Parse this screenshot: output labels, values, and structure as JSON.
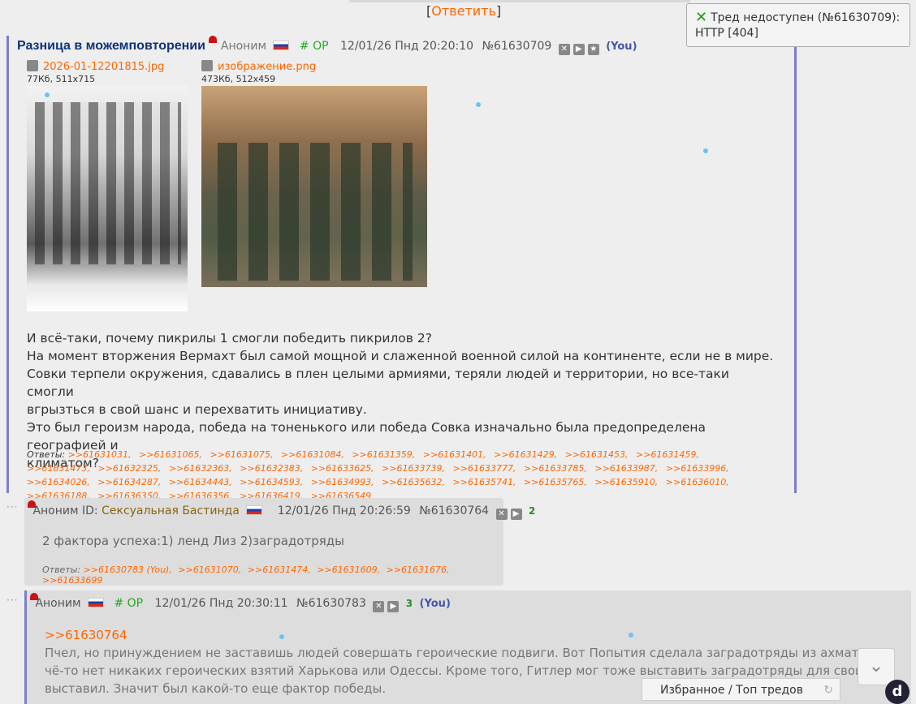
{
  "top_reply": {
    "open": "[",
    "label": "Ответить",
    "close": "]"
  },
  "notice": {
    "text_line1": "Тред недоступен (№61630709):",
    "text_line2": "HTTP [404]"
  },
  "op": {
    "title": "Разница в можемповторении",
    "author": "Аноним",
    "op_tag": "# OP",
    "date": "12/01/26 Пнд 20:20:10",
    "number": "№61630709",
    "you": "(You)",
    "files": [
      {
        "name": "2026-01-12201815.jpg",
        "meta": "77Кб, 511x715"
      },
      {
        "name": "изображение.png",
        "meta": "473Кб, 512x459"
      }
    ],
    "body": [
      "И всё-таки, почему пикрилы 1 смогли победить пикрилов 2?",
      "На момент вторжения Вермахт был самой мощной и слаженной военной силой на континенте, если не в мире.",
      "Совки терпели окружения, сдавались в плен целыми армиями, теряли людей и территории, но все-таки смогли",
      "вгрызться в свой шанс и перехватить инициативу.",
      "Это был героизм народа, победа на тоненького или победа Совка изначально была предопределена географией и",
      "климатом?"
    ],
    "replies_label": "Ответы:",
    "replies": [
      ">>61631031",
      ">>61631065",
      ">>61631075",
      ">>61631084",
      ">>61631359",
      ">>61631401",
      ">>61631429",
      ">>61631453",
      ">>61631459",
      ">>61631473",
      ">>61632325",
      ">>61632363",
      ">>61632383",
      ">>61633625",
      ">>61633739",
      ">>61633777",
      ">>61633785",
      ">>61633987",
      ">>61633996",
      ">>61634026",
      ">>61634287",
      ">>61634443",
      ">>61634593",
      ">>61634993",
      ">>61635632",
      ">>61635741",
      ">>61635765",
      ">>61635910",
      ">>61636010",
      ">>61636188",
      ">>61636350",
      ">>61636356",
      ">>61636419",
      ">>61636549"
    ]
  },
  "reply1": {
    "author": "Аноним",
    "id_label": "ID:",
    "id_name": "Сексуальная Бастинда",
    "date": "12/01/26 Пнд 20:26:59",
    "number": "№61630764",
    "count": "2",
    "body": "2 фактора успеха:1) ленд Лиз 2)заградотряды",
    "replies_label": "Ответы:",
    "replies": [
      ">>61630783 (You),",
      ">>61631070,",
      ">>61631474,",
      ">>61631609,",
      ">>61631676,",
      ">>61633699"
    ]
  },
  "reply2": {
    "author": "Аноним",
    "op_tag": "# OP",
    "date": "12/01/26 Пнд 20:30:11",
    "number": "№61630783",
    "count": "3",
    "you": "(You)",
    "quote": ">>61630764",
    "body": [
      "Пчел, но принуждением не заставишь людей совершать героические подвиги. Вот Попытия сделала заградотряды из ахматовце",
      "чё-то нет никаких героических взятий Харькова или Одессы. Кроме того, Гитлер мог тоже выставить заградотряды для своих, н",
      "выставил. Значит был какой-то еще фактор победы."
    ]
  },
  "bottom": {
    "favorites": "Избранное / Топ тредов",
    "logo": "d"
  }
}
